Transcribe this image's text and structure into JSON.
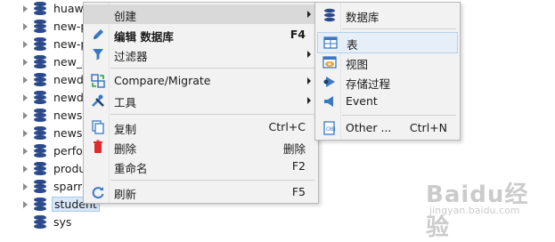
{
  "tree": {
    "items": [
      {
        "label": "huawe"
      },
      {
        "label": "new-p"
      },
      {
        "label": "new-p"
      },
      {
        "label": "new_s"
      },
      {
        "label": "newdi"
      },
      {
        "label": "newdi"
      },
      {
        "label": "newsc"
      },
      {
        "label": "newsc"
      },
      {
        "label": "perfo"
      },
      {
        "label": "produ"
      },
      {
        "label": "sparr"
      },
      {
        "label": "student",
        "selected": true
      },
      {
        "label": "sys"
      }
    ]
  },
  "context_menu": {
    "items": [
      {
        "label": "创建",
        "has_submenu": true,
        "icon": "none"
      },
      {
        "label": "编辑 数据库",
        "shortcut": "F4",
        "bold": true,
        "icon": "pencil-icon"
      },
      {
        "label": "过滤器",
        "has_submenu": true,
        "icon": "filter-icon"
      },
      {
        "label": "Compare/Migrate",
        "has_submenu": true,
        "icon": "compare-icon"
      },
      {
        "label": "工具",
        "has_submenu": true,
        "icon": "tools-icon"
      },
      {
        "label": "复制",
        "shortcut": "Ctrl+C",
        "icon": "copy-icon"
      },
      {
        "label": "删除",
        "shortcut": "删除",
        "icon": "delete-icon"
      },
      {
        "label": "重命名",
        "shortcut": "F2",
        "icon": "none"
      },
      {
        "label": "刷新",
        "shortcut": "F5",
        "icon": "refresh-icon"
      }
    ]
  },
  "sub_menu": {
    "items": [
      {
        "label": "数据库",
        "icon": "database-icon"
      },
      {
        "label": "表",
        "icon": "table-icon",
        "highlighted": true
      },
      {
        "label": "视图",
        "icon": "view-icon"
      },
      {
        "label": "存储过程",
        "icon": "procedure-icon"
      },
      {
        "label": "Event",
        "icon": "event-icon"
      },
      {
        "label": "Other ...",
        "shortcut": "Ctrl+N",
        "icon": "other-icon"
      }
    ]
  },
  "watermark": {
    "text": "Baidu经验",
    "sub": "jingyan.baidu.com"
  },
  "colors": {
    "db_icon": "#2b4a8c",
    "menu_bg": "#f2f2f2",
    "highlight": "#e6eef8"
  }
}
